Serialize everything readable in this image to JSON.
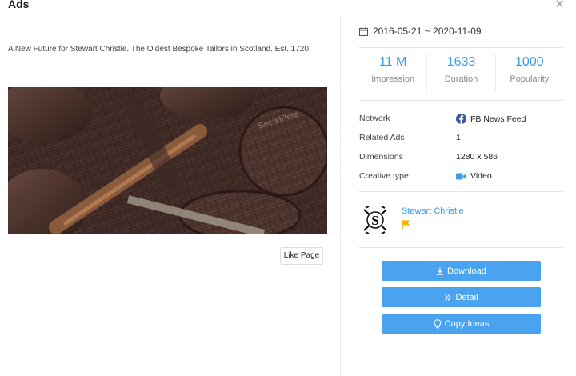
{
  "header": {
    "title": "Ads",
    "close_icon": "close-icon"
  },
  "ad": {
    "caption": "A New Future for Stewart Christie. The Oldest Bespoke Tailors in Scotland. Est. 1720.",
    "media_watermark": "SocialPeta",
    "like_page_label": "Like Page"
  },
  "date_range": "2016-05-21 ~ 2020-11-09",
  "stats": [
    {
      "value": "11 M",
      "label": "Impression"
    },
    {
      "value": "1633",
      "label": "Duration"
    },
    {
      "value": "1000",
      "label": "Popularity"
    }
  ],
  "details": [
    {
      "key": "Network",
      "value": "FB News Feed",
      "icon": "facebook-icon"
    },
    {
      "key": "Related Ads",
      "value": "1"
    },
    {
      "key": "Dimensions",
      "value": "1280 x 586"
    },
    {
      "key": "Creative type",
      "value": "Video",
      "icon": "video-camera-icon"
    }
  ],
  "advertiser": {
    "name": "Stewart Christie",
    "logo_letter": "S"
  },
  "actions": [
    {
      "label": "Download",
      "icon": "download-icon"
    },
    {
      "label": "Detail",
      "icon": "double-chevron-right-icon"
    },
    {
      "label": "Copy Ideas",
      "icon": "lightbulb-icon"
    }
  ],
  "colors": {
    "accent": "#3b9ee4",
    "button": "#4aa3ef",
    "flag": "#f0b400",
    "facebook": "#3b5998"
  }
}
